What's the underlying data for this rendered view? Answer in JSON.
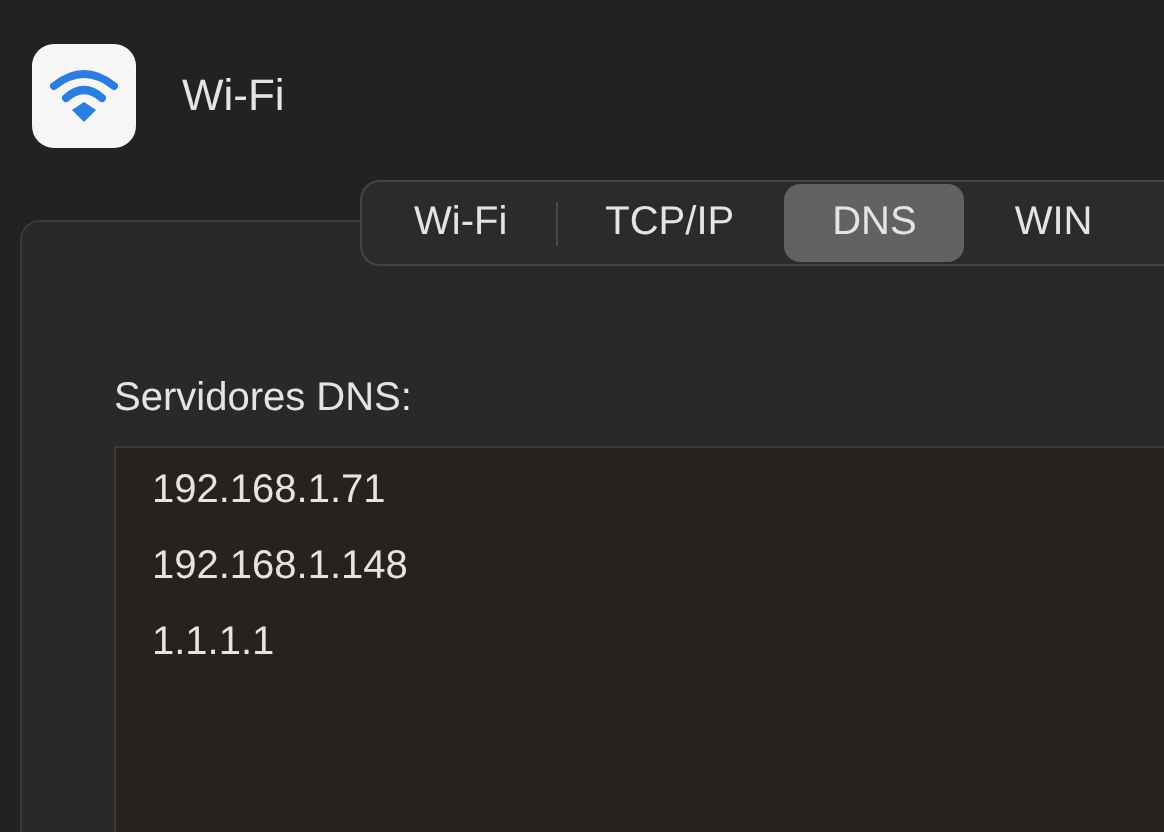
{
  "window": {
    "title": "Wi-Fi"
  },
  "tabs": [
    {
      "label": "Wi-Fi",
      "selected": false
    },
    {
      "label": "TCP/IP",
      "selected": false
    },
    {
      "label": "DNS",
      "selected": true
    },
    {
      "label": "WIN",
      "selected": false
    }
  ],
  "dns_servers": {
    "label": "Servidores DNS:",
    "entries": [
      "192.168.1.71",
      "192.168.1.148",
      "1.1.1.1"
    ]
  }
}
